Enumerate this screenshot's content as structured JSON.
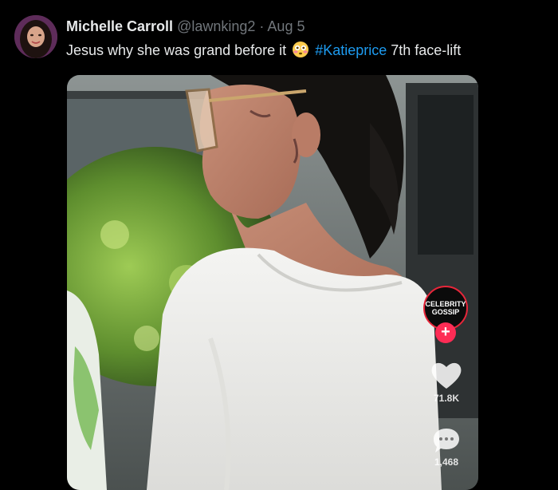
{
  "tweet": {
    "author_name": "Michelle Carroll",
    "handle": "@lawnking2",
    "separator": "·",
    "date": "Aug 5",
    "text_before": "Jesus why she was grand before it",
    "emoji": "flushed-face-emoji",
    "hashtag": "#Katieprice",
    "text_after": "7th face-lift"
  },
  "media": {
    "overlay": {
      "channel_badge_line1": "CELEBRITY",
      "channel_badge_line2": "GOSSIP",
      "follow_symbol": "+",
      "like_icon": "heart-icon",
      "like_count": "71.8K",
      "comment_icon": "comment-bubble-icon",
      "comment_count": "1,468"
    }
  },
  "colors": {
    "background": "#000000",
    "text_primary": "#e7e9ea",
    "text_secondary": "#71767b",
    "link": "#1d9bf0",
    "follow_button": "#fe2c55"
  }
}
